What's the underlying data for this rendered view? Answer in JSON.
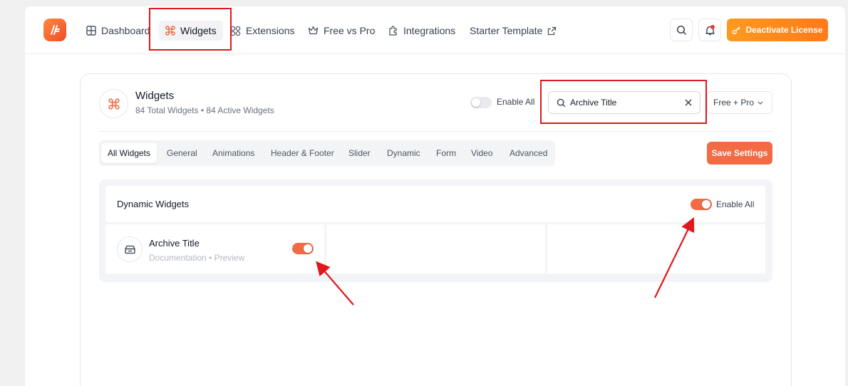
{
  "colors": {
    "accent": "#f26b45",
    "license_gradient": [
      "#ff9a1f",
      "#ff7a1a"
    ],
    "annotation_red": "#e0171b"
  },
  "nav": {
    "logo_icon": "brand-logo-icon",
    "items": [
      {
        "label": "Dashboard",
        "icon": "grid-icon"
      },
      {
        "label": "Widgets",
        "icon": "command-icon",
        "active": true
      },
      {
        "label": "Extensions",
        "icon": "extensions-icon"
      },
      {
        "label": "Free vs Pro",
        "icon": "crown-icon"
      },
      {
        "label": "Integrations",
        "icon": "puzzle-icon"
      },
      {
        "label": "Starter Template",
        "icon": "external-link-icon"
      }
    ],
    "search_icon": "search-icon",
    "notification_icon": "bell-icon",
    "license_button": "Deactivate License"
  },
  "panel": {
    "title": "Widgets",
    "subtitle": "84 Total Widgets • 84 Active Widgets",
    "enable_all": {
      "label": "Enable All",
      "enabled": false
    },
    "search": {
      "value": "Archive Title",
      "placeholder": "Search widgets"
    },
    "filter": {
      "selected": "Free + Pro"
    },
    "tabs": [
      {
        "label": "All Widgets",
        "active": true
      },
      {
        "label": "General"
      },
      {
        "label": "Animations"
      },
      {
        "label": "Header & Footer"
      },
      {
        "label": "Slider"
      },
      {
        "label": "Dynamic"
      },
      {
        "label": "Form"
      },
      {
        "label": "Video"
      },
      {
        "label": "Advanced"
      }
    ],
    "save_button": "Save Settings",
    "section": {
      "title": "Dynamic Widgets",
      "enable_all": {
        "label": "Enable All",
        "enabled": true
      },
      "widgets": [
        {
          "title": "Archive Title",
          "doc_label": "Documentation",
          "separator": "•",
          "preview_label": "Preview",
          "enabled": true,
          "icon": "archive-box-icon"
        }
      ]
    }
  }
}
